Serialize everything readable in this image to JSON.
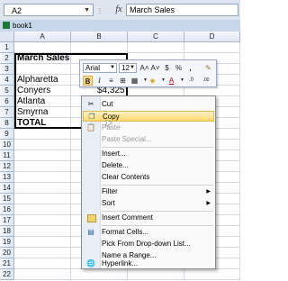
{
  "formula_bar": {
    "name_box": "A2",
    "fx": "fx",
    "content": "March Sales"
  },
  "workbook": {
    "title": "book1"
  },
  "columns": [
    "A",
    "B",
    "C",
    "D"
  ],
  "rows": [
    "1",
    "2",
    "3",
    "4",
    "5",
    "6",
    "7",
    "8",
    "9",
    "10",
    "11",
    "12",
    "13",
    "14",
    "15",
    "16",
    "17",
    "18",
    "19",
    "20",
    "21",
    "22"
  ],
  "cells": {
    "a2": "March Sales",
    "a4": "Alpharetta",
    "a5": "Conyers",
    "b5": "$4,325",
    "a6": "Atlanta",
    "a7": "Smyrna",
    "a8": "TOTAL"
  },
  "mini_toolbar": {
    "font": "Arial",
    "size": "12",
    "grow_font": "A˄",
    "shrink_font": "A˅",
    "currency": "$",
    "percent": "%",
    "comma": ",",
    "format_painter_icon": "paintbrush-icon",
    "bold": "B",
    "italic": "I",
    "font_color": "A",
    "inc_decimal": ".0",
    "dec_decimal": ".00"
  },
  "context_menu": {
    "items": [
      {
        "label": "Cut",
        "icon": "scissors-icon",
        "enabled": true
      },
      {
        "label": "Copy",
        "icon": "copy-icon",
        "enabled": true,
        "highlighted": true
      },
      {
        "label": "Paste",
        "icon": "paste-icon",
        "enabled": false
      },
      {
        "label": "Paste Special...",
        "enabled": false
      },
      {
        "label": "Insert...",
        "enabled": true
      },
      {
        "label": "Delete...",
        "enabled": true
      },
      {
        "label": "Clear Contents",
        "enabled": true
      },
      {
        "label": "Filter",
        "enabled": true,
        "submenu": true
      },
      {
        "label": "Sort",
        "enabled": true,
        "submenu": true
      },
      {
        "label": "Insert Comment",
        "icon": "comment-icon",
        "enabled": true
      },
      {
        "label": "Format Cells...",
        "icon": "format-cells-icon",
        "enabled": true
      },
      {
        "label": "Pick From Drop-down List...",
        "enabled": true
      },
      {
        "label": "Name a Range...",
        "enabled": true
      },
      {
        "label": "Hyperlink...",
        "icon": "hyperlink-icon",
        "enabled": true
      }
    ]
  },
  "colors": {
    "selection_border": "#000000",
    "menu_highlight": "#ffd96a",
    "header_bg": "#dde6f1"
  }
}
